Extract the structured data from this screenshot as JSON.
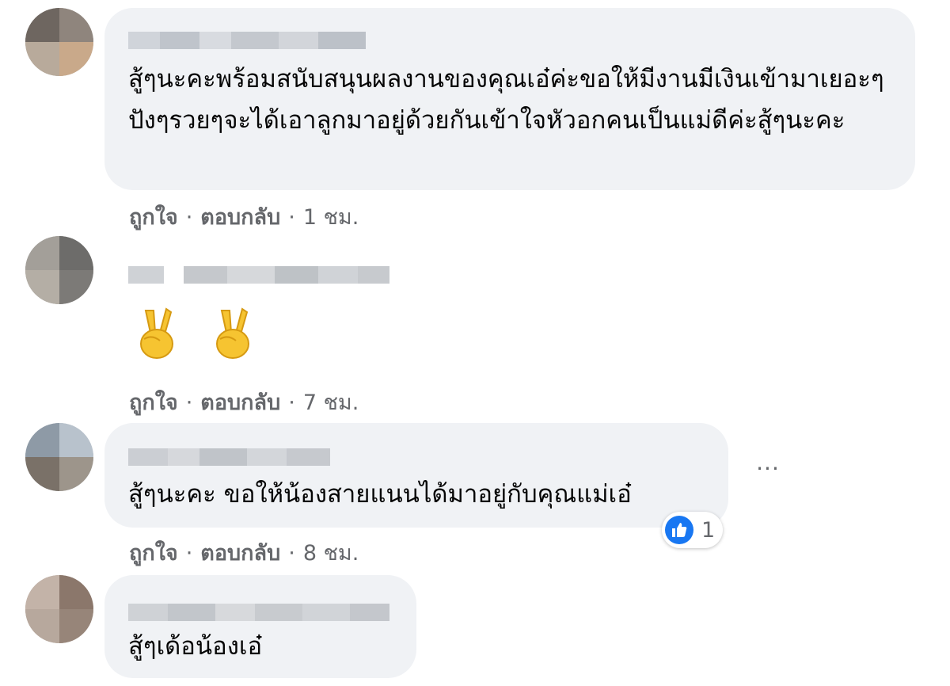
{
  "comments": [
    {
      "text": "สู้ๆนะคะพร้อมสนับสนุนผลงานของคุณเอ๋ค่ะขอให้มีงานมีเงินเข้ามาเยอะๆปังๆรวยๆจะได้เอาลูกมาอยู่ด้วยกันเข้าใจหัวอกคนเป็นแม่ดีค่ะสู้ๆนะคะ",
      "like_label": "ถูกใจ",
      "reply_label": "ตอบกลับ",
      "time": "1 ชม."
    },
    {
      "emoji": [
        "✌",
        "✌"
      ],
      "like_label": "ถูกใจ",
      "reply_label": "ตอบกลับ",
      "time": "7 ชม."
    },
    {
      "text": "สู้ๆนะคะ ขอให้น้องสายแนนได้มาอยู่กับคุณแม่เอ๋",
      "like_label": "ถูกใจ",
      "reply_label": "ตอบกลับ",
      "time": "8 ชม.",
      "reaction_count": "1",
      "more_label": "···"
    },
    {
      "text": "สู้ๆเด้อน้องเอ๋"
    }
  ],
  "colors": {
    "bubble": "#f0f2f5",
    "meta_text": "#65676b",
    "like_blue": "#1877f2"
  },
  "icons": {
    "more": "more-options-icon",
    "like": "thumbs-up-icon",
    "emoji": "victory-hand-emoji"
  }
}
